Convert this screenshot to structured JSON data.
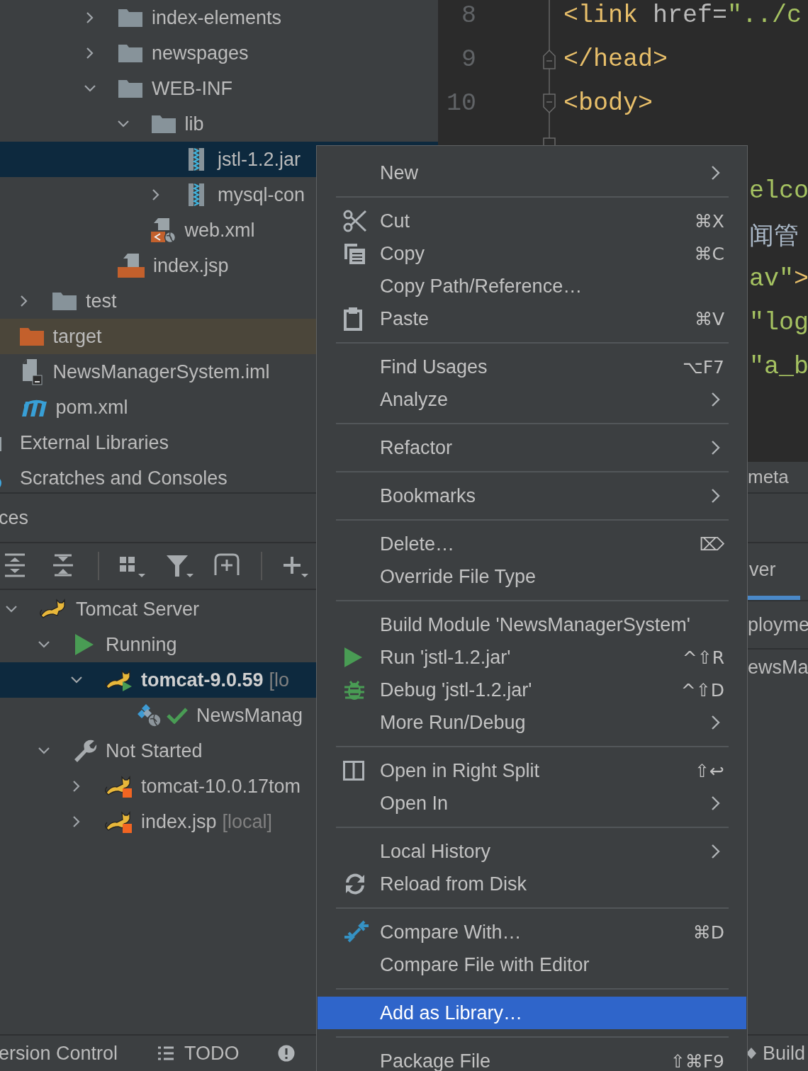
{
  "project_tree": [
    {
      "children": [
        {
          "children": [
            {
              "children": [
                {
                  "children": [
                    {
                      "label": "index-elements",
                      "kind": "folder",
                      "expanded": false,
                      "selected": false
                    },
                    {
                      "label": "newspages",
                      "kind": "folder",
                      "expanded": false,
                      "selected": false
                    },
                    {
                      "label": "WEB-INF",
                      "kind": "folder",
                      "expanded": true,
                      "selected": false,
                      "children": [
                        {
                          "label": "lib",
                          "kind": "folder",
                          "expanded": true,
                          "selected": false,
                          "children": [
                            {
                              "label": "jstl-1.2.jar",
                              "kind": "jar",
                              "selected": true
                            },
                            {
                              "label": "mysql-con",
                              "kind": "jar",
                              "expanded": false,
                              "selected": false
                            }
                          ]
                        },
                        {
                          "label": "web.xml",
                          "kind": "xml",
                          "selected": false
                        }
                      ]
                    },
                    {
                      "label": "index.jsp",
                      "kind": "jsp",
                      "selected": false
                    }
                  ]
                }
              ]
            },
            {
              "label": "test",
              "kind": "folder",
              "expanded": false,
              "selected": false
            }
          ]
        },
        {
          "label": "target",
          "kind": "excluded-folder",
          "selected": false
        },
        {
          "label": "NewsManagerSystem.iml",
          "kind": "module-file",
          "selected": false
        },
        {
          "label": "pom.xml",
          "kind": "pom",
          "selected": false
        }
      ]
    },
    {
      "label": "External Libraries",
      "kind": "libraries",
      "selected": false
    },
    {
      "label": "Scratches and Consoles",
      "kind": "scratches",
      "selected": false
    }
  ],
  "editor": {
    "lines": [
      {
        "kind": "plain",
        "number": "8",
        "segments": [
          {
            "text": "<link ",
            "kind": "tag"
          },
          {
            "text": "href=",
            "kind": "attribute"
          },
          {
            "text": "\"../c",
            "kind": "string"
          }
        ]
      },
      {
        "kind": "fold-end",
        "number": "9",
        "segments": [
          {
            "text": "</head>",
            "kind": "tag"
          }
        ]
      },
      {
        "kind": "fold-start",
        "number": "10",
        "segments": [
          {
            "text": "<body>",
            "kind": "tag"
          }
        ]
      },
      {
        "kind": "fold-start"
      },
      {
        "kind": "partial",
        "segments": [
          {
            "text": "elco",
            "kind": "string"
          }
        ]
      },
      {
        "kind": "partial",
        "segments": [
          {
            "text": "闻管",
            "kind": "text"
          }
        ]
      },
      {
        "kind": "partial",
        "segments": [
          {
            "text": "av\"",
            "kind": "string"
          },
          {
            "text": ">",
            "kind": "tag"
          }
        ]
      },
      {
        "kind": "partial",
        "segments": [
          {
            "text": "\"log",
            "kind": "string"
          }
        ]
      },
      {
        "kind": "partial",
        "segments": [
          {
            "text": "\"a_b",
            "kind": "string"
          }
        ]
      }
    ]
  },
  "editor_tabs": [
    "meta"
  ],
  "services": {
    "title": "ces",
    "tree": [
      {
        "label": "Tomcat Server",
        "kind": "server",
        "expanded": true,
        "selected": false,
        "children": [
          {
            "label": "Running",
            "kind": "running-group",
            "expanded": true,
            "selected": false,
            "children": [
              {
                "label": "tomcat-9.0.59",
                "suffix": "[lo",
                "kind": "tomcat-running",
                "expanded": true,
                "selected": true,
                "children": [
                  {
                    "label": "NewsManag",
                    "kind": "artifact",
                    "selected": false
                  }
                ]
              }
            ]
          },
          {
            "label": "Not Started",
            "kind": "stopped-group",
            "expanded": true,
            "selected": false,
            "children": [
              {
                "label": "tomcat-10.0.17tom",
                "kind": "tomcat-stopped",
                "expanded": false,
                "selected": false
              },
              {
                "label": "index.jsp",
                "suffix": "[local]",
                "kind": "tomcat-stopped",
                "expanded": false,
                "selected": false
              }
            ]
          }
        ]
      }
    ],
    "detail_tabs": [
      {
        "label": "ver",
        "selected": true
      }
    ],
    "detail_rows": [
      "ployme",
      "ewsMa"
    ]
  },
  "context_menu": {
    "items": [
      {
        "kind": "item",
        "label": "New",
        "submenu": true,
        "selected": false
      },
      {
        "kind": "separator"
      },
      {
        "kind": "item",
        "label": "Cut",
        "shortcut": "⌘X",
        "submenu": false,
        "selected": false
      },
      {
        "kind": "item",
        "label": "Copy",
        "shortcut": "⌘C",
        "submenu": false,
        "selected": false
      },
      {
        "kind": "item",
        "label": "Copy Path/Reference…",
        "submenu": false,
        "selected": false
      },
      {
        "kind": "item",
        "label": "Paste",
        "shortcut": "⌘V",
        "submenu": false,
        "selected": false
      },
      {
        "kind": "separator"
      },
      {
        "kind": "item",
        "label": "Find Usages",
        "shortcut": "⌥F7",
        "submenu": false,
        "selected": false
      },
      {
        "kind": "item",
        "label": "Analyze",
        "submenu": true,
        "selected": false
      },
      {
        "kind": "separator"
      },
      {
        "kind": "item",
        "label": "Refactor",
        "submenu": true,
        "selected": false
      },
      {
        "kind": "separator"
      },
      {
        "kind": "item",
        "label": "Bookmarks",
        "submenu": true,
        "selected": false
      },
      {
        "kind": "separator"
      },
      {
        "kind": "item",
        "label": "Delete…",
        "shortcut": "⌦",
        "submenu": false,
        "selected": false
      },
      {
        "kind": "item",
        "label": "Override File Type",
        "submenu": false,
        "selected": false
      },
      {
        "kind": "separator"
      },
      {
        "kind": "item",
        "label": "Build Module 'NewsManagerSystem'",
        "submenu": false,
        "selected": false
      },
      {
        "kind": "item",
        "label": "Run 'jstl-1.2.jar'",
        "shortcut": "^⇧R",
        "submenu": false,
        "selected": false
      },
      {
        "kind": "item",
        "label": "Debug 'jstl-1.2.jar'",
        "shortcut": "^⇧D",
        "submenu": false,
        "selected": false
      },
      {
        "kind": "item",
        "label": "More Run/Debug",
        "submenu": true,
        "selected": false
      },
      {
        "kind": "separator"
      },
      {
        "kind": "item",
        "label": "Open in Right Split",
        "shortcut": "⇧↩",
        "submenu": false,
        "selected": false
      },
      {
        "kind": "item",
        "label": "Open In",
        "submenu": true,
        "selected": false
      },
      {
        "kind": "separator"
      },
      {
        "kind": "item",
        "label": "Local History",
        "submenu": true,
        "selected": false
      },
      {
        "kind": "item",
        "label": "Reload from Disk",
        "submenu": false,
        "selected": false
      },
      {
        "kind": "separator"
      },
      {
        "kind": "item",
        "label": "Compare With…",
        "shortcut": "⌘D",
        "submenu": false,
        "selected": false
      },
      {
        "kind": "item",
        "label": "Compare File with Editor",
        "submenu": false,
        "selected": false
      },
      {
        "kind": "separator"
      },
      {
        "kind": "item",
        "label": "Add as Library…",
        "submenu": false,
        "selected": true
      },
      {
        "kind": "separator"
      },
      {
        "kind": "item",
        "label": "Package File",
        "shortcut": "⇧⌘F9",
        "submenu": false,
        "selected": false
      }
    ]
  },
  "bottom_bar": {
    "left": [
      "ersion Control",
      "TODO"
    ],
    "right": [
      "Build"
    ]
  }
}
